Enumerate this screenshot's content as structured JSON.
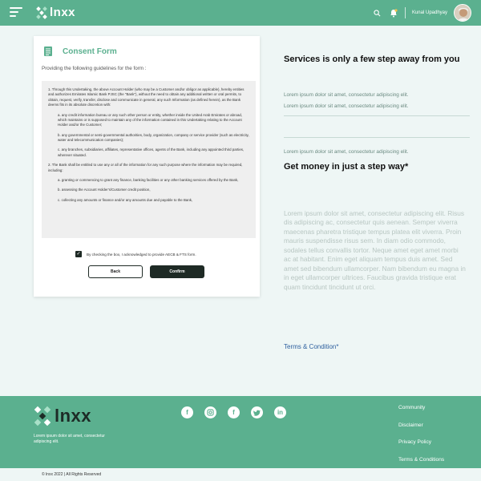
{
  "header": {
    "brand": "lnxx",
    "username": "Kunal Upadhyay",
    "icons": [
      "menu-icon",
      "search-icon",
      "notification-icon"
    ]
  },
  "consent": {
    "title": "Consent Form",
    "subtitle": "Providing the following guidelines for the form :",
    "p1": "1. Through this Undertaking, the above Account Holder (who may be a Customer and/or obligor as applicable), hereby entities and authorizes Emirates Islamic Bank PJSC (the \"Bank\"), without the need to obtain any additional written or oral permits, to obtain, request, verify, transfer, disclose and communicate in general, any such Information (as defined herein), as the Bank deems fits in its absolute discretion with:",
    "p1a": "a. any credit information bureau or any such other person or entity, whether inside the United Arab Emirates or abroad, which maintains or is supposed to maintain any of the information contained in this Undertaking relating to the Account Holder and/or the Customer;",
    "p1b": "b. any governmental or semi-governmental authorities, body, organization, company or service provider (such as electricity, water and telecommunication companies);",
    "p1c": "c. any branches, subsidiaries, affiliates, representative offices, agents of the Bank, including any appointed third parties, wherever situated.",
    "p2": "2. The Bank shall be entitled to use any or all of the information for any such purpose where the information may be required, including:",
    "p2a": "a. granting or commencing to grant any finance, banking facilities or any other banking services offered by the Bank,",
    "p2b": "b. assessing the Account Holder's/Customer credit position,",
    "p2c": "c. collecting any amounts or finance and/or any amounts due and payable to the Bank,",
    "agree_text": "By checking the box, I acknowledged to provide AECB & FTS  form.",
    "agree_checked": true,
    "back_label": "Back",
    "confirm_label": "Confirm"
  },
  "info": {
    "heading1": "Services is only a few step away from you",
    "lorem1": "Lorem ipsum dolor sit amet, consectetur adipiscing elit.",
    "lorem2": "Lorem ipsum dolor sit amet, consectetur adipiscing elit.",
    "lorem3": "Lorem ipsum dolor sit amet, consectetur adipiscing elit.",
    "heading2": "Get money in just a step way*",
    "paragraph": "Lorem ipsum dolor sit amet, consectetur adipiscing elit. Risus dis adipiscing ac, consectetur quis aenean. Semper viverra maecenas pharetra tristique tempus platea elit viverra. Proin mauris suspendisse risus sem. In diam odio commodo, sodales tellus convallis tortor. Neque amet eget amet morbi ac at habitant. Enim eget aliquam tempus duis amet. Sed amet sed bibendum ullamcorper. Nam bibendum eu magna in in eget ullamcorper ultrices. Faucibus gravida tristique erat quam tincidunt tincidunt ut orci.",
    "terms_link": "Terms & Condition*"
  },
  "footer": {
    "brand": "lnxx",
    "tagline": "Lorem ipsum dolor sit amet, consectetur adipiscing elit.",
    "links": [
      "Community",
      "Disclaimer",
      "Privacy Policy",
      "Terms & Conditions"
    ],
    "socials": [
      "facebook-icon",
      "instagram-icon",
      "facebook-icon",
      "twitter-icon",
      "linkedin-icon"
    ],
    "copyright": "© lnxx 2022 | All Rights Reserved"
  },
  "colors": {
    "primary": "#5bb08f",
    "dark": "#1e2a25",
    "link": "#2d5f9e",
    "background": "#eef6f5"
  }
}
